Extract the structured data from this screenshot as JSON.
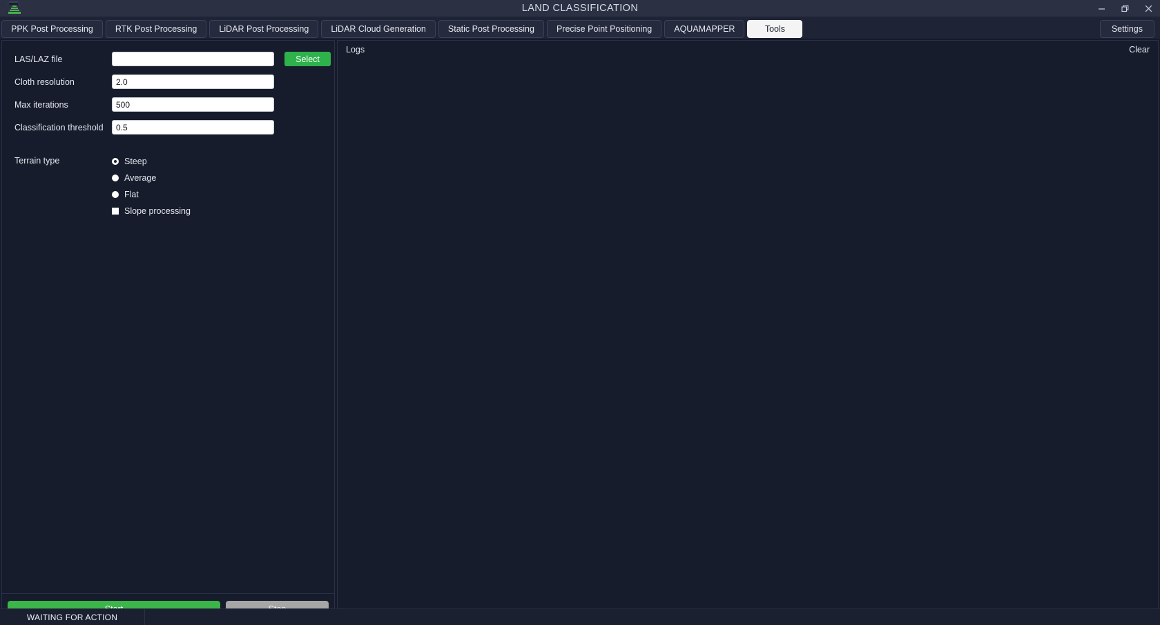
{
  "window": {
    "title": "LAND CLASSIFICATION",
    "logo_icon": "pyramid-logo-icon",
    "controls": {
      "minimize": "minimize-icon",
      "maximize": "restore-icon",
      "close": "close-icon"
    }
  },
  "tabs": [
    {
      "label": "PPK Post Processing",
      "active": false
    },
    {
      "label": "RTK Post Processing",
      "active": false
    },
    {
      "label": "LiDAR Post Processing",
      "active": false
    },
    {
      "label": "LiDAR Cloud Generation",
      "active": false
    },
    {
      "label": "Static Post Processing",
      "active": false
    },
    {
      "label": "Precise Point Positioning",
      "active": false
    },
    {
      "label": "AQUAMAPPER",
      "active": false
    },
    {
      "label": "Tools",
      "active": true
    }
  ],
  "settings_button": "Settings",
  "form": {
    "las_file": {
      "label": "LAS/LAZ file",
      "value": "",
      "placeholder": "",
      "button": "Select"
    },
    "cloth_resolution": {
      "label": "Cloth resolution",
      "value": "2.0"
    },
    "max_iterations": {
      "label": "Max iterations",
      "value": "500"
    },
    "classification_threshold": {
      "label": "Classification threshold",
      "value": "0.5"
    },
    "terrain_type": {
      "label": "Terrain type",
      "options": [
        {
          "label": "Steep",
          "selected": true
        },
        {
          "label": "Average",
          "selected": false
        },
        {
          "label": "Flat",
          "selected": false
        }
      ]
    },
    "slope_processing": {
      "label": "Slope processing",
      "checked": false
    }
  },
  "actions": {
    "start": "Start",
    "stop": "Stop"
  },
  "logs": {
    "title": "Logs",
    "clear": "Clear",
    "entries": []
  },
  "status": {
    "message": "WAITING FOR ACTION"
  },
  "colors": {
    "accent_green": "#3cb54a",
    "select_green": "#2eb24c",
    "stop_gray": "#a6a6a6",
    "window_bg": "#161b2b",
    "panel_bg": "#171c2c",
    "titlebar_bg": "#2b3043",
    "tab_bg": "#252a3d",
    "tab_active_bg": "#f4f4f4"
  }
}
